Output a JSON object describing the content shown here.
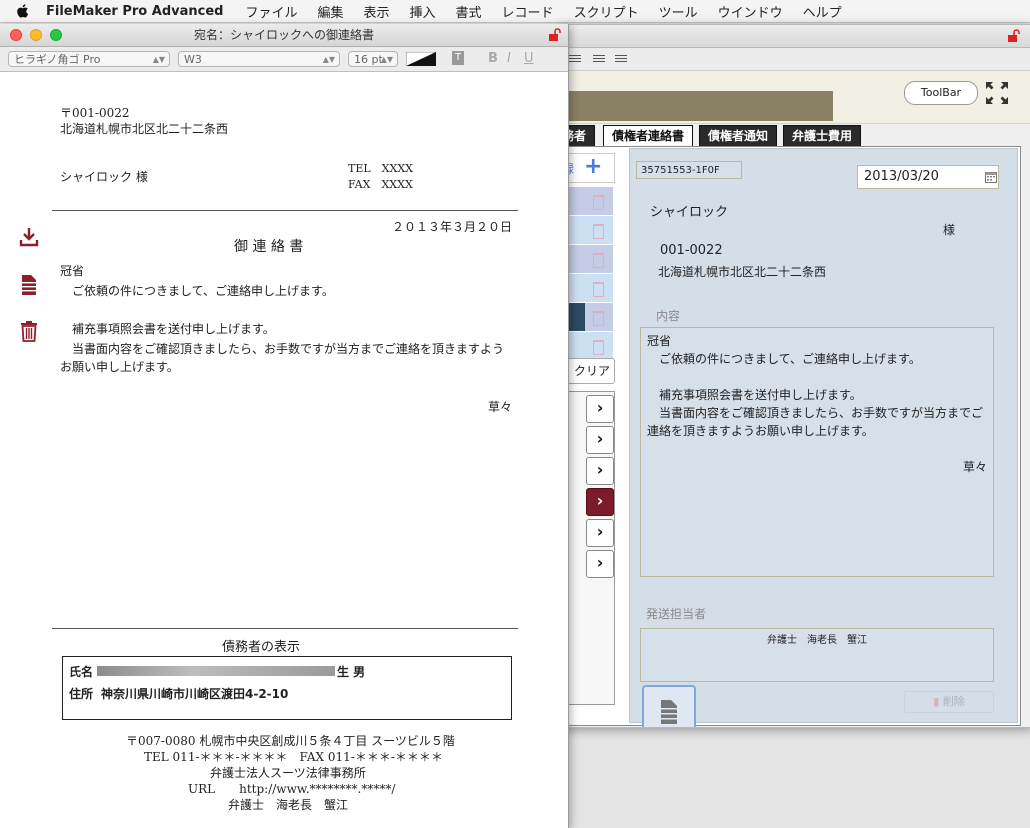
{
  "menubar": {
    "app_name": "FileMaker Pro Advanced",
    "items": [
      "ファイル",
      "編集",
      "表示",
      "挿入",
      "書式",
      "レコード",
      "スクリプト",
      "ツール",
      "ウインドウ",
      "ヘルプ"
    ]
  },
  "front": {
    "title": "宛名：シャイロックへの御連絡書",
    "font_name": "ヒラギノ角ゴ Pro",
    "font_weight": "W3",
    "font_size": "16 pt",
    "style_b": "B",
    "style_i": "I",
    "style_u": "U",
    "postal": "〒001-0022",
    "address": "北海道札幌市北区北二十二条西",
    "recipient": "シャイロック 様",
    "tel": "TEL　XXXX",
    "fax": "FAX　XXXX",
    "date": "２０１３年３月２０日",
    "doc_title": "御 連 絡 書",
    "body_lines": [
      "冠省",
      "　ご依頼の件につきまして、ご連絡申し上げます。",
      "",
      "　補充事項照会書を送付申し上げます。",
      "　当書面内容をご確認頂きましたら、お手数ですが当方までご連絡を頂きますよう",
      "お願い申し上げます。"
    ],
    "closing": "草々",
    "debtor_heading": "債務者の表示",
    "debtor_name_label": "氏名",
    "debtor_name_suffix": "生 男",
    "debtor_address_label": "住所",
    "debtor_address": "神奈川県川崎市川崎区渡田4-2-10",
    "footer_lines": [
      "〒007-0080 札幌市中央区創成川５条４丁目 スーツビル５階",
      "TEL 011-＊＊＊-＊＊＊＊　FAX 011-＊＊＊-＊＊＊＊",
      "弁護士法人スーツ法律事務所",
      "URL　　http://www.********.*****/",
      "弁護士　海老長　蟹江"
    ]
  },
  "back": {
    "toolbar_label": "ToolBar",
    "tabs": [
      "務者",
      "債権者連絡書",
      "債権者通知",
      "弁護士費用"
    ],
    "clear_label": "クリア",
    "left_fragment": "録",
    "record_id": "35751553-1F0F",
    "date_value": "2013/03/20",
    "name": "シャイロック",
    "honorific": "様",
    "postal": "001-0022",
    "address": "北海道札幌市北区北二十二条西",
    "content_label": "内容",
    "content_lines": [
      "冠省",
      "　ご依頼の件につきまして、ご連絡申し上げます。",
      "",
      "　補充事項照会書を送付申し上げます。",
      "　当書面内容をご確認頂きましたら、お手数ですが当方までご",
      "連絡を頂きますようお願い申し上げます。"
    ],
    "closing": "草々",
    "sender_label": "発送担当者",
    "sender_value": "弁護士　海老長　蟹江",
    "delete_label": "削除"
  },
  "colors": {
    "active_row": "#7b1c2a",
    "panel": "#d3dee7",
    "header_band": "#8a8064"
  }
}
